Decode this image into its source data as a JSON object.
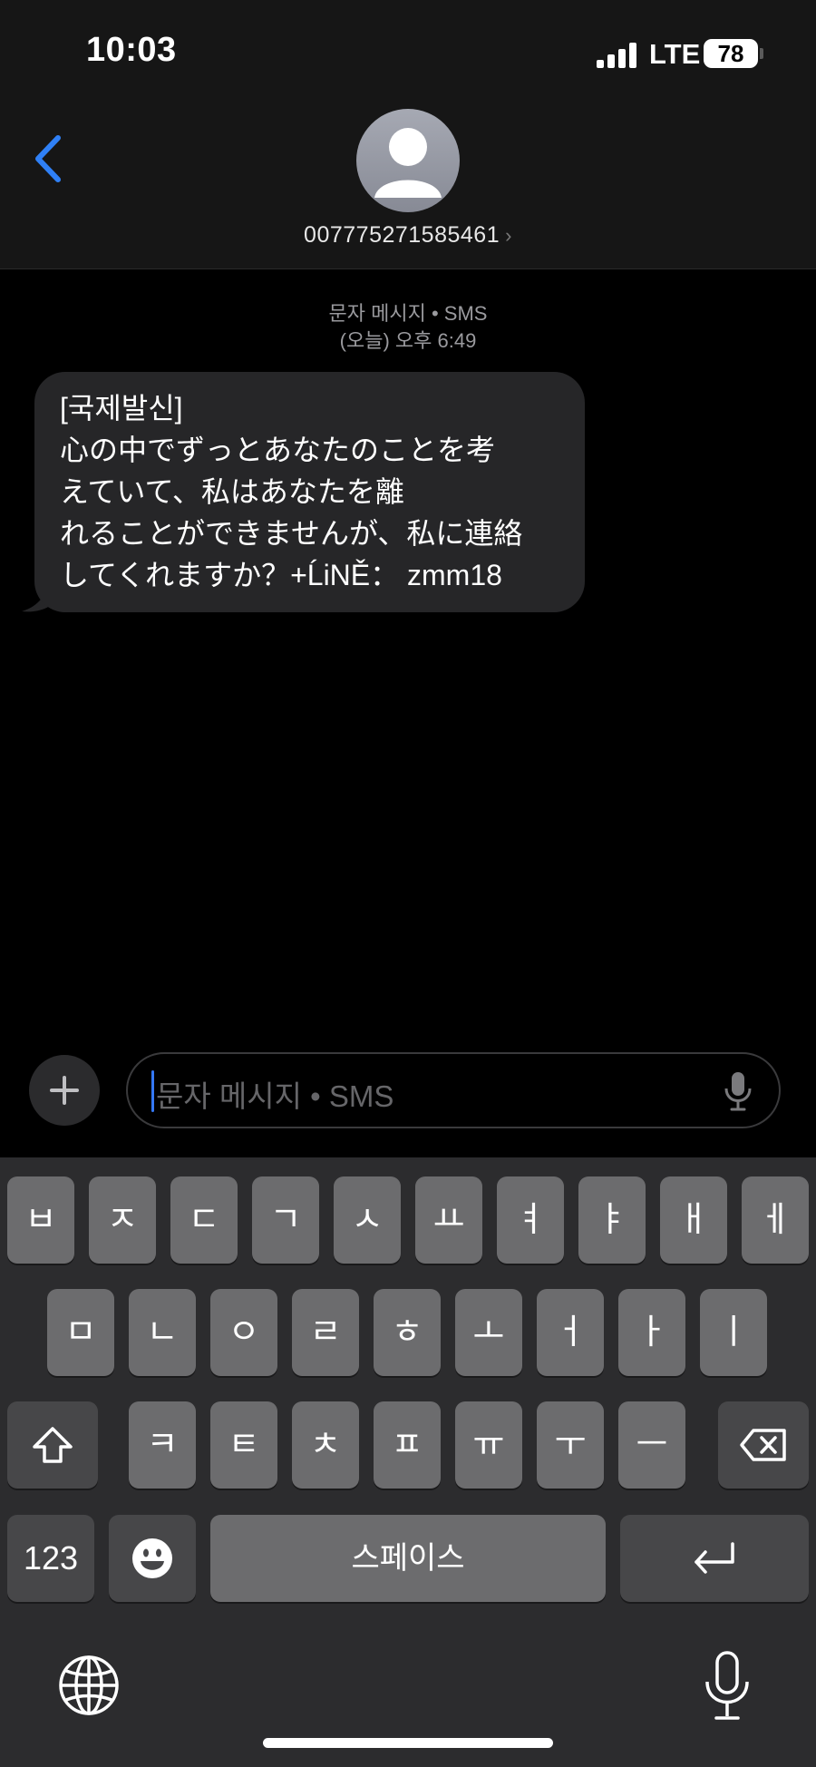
{
  "status_bar": {
    "time": "10:03",
    "network": "LTE",
    "battery": "78"
  },
  "header": {
    "contact_name": "007775271585461",
    "chevron": "›"
  },
  "conversation": {
    "meta_type": "문자 메시지 • SMS",
    "meta_timestamp": "(오늘) 오후 6:49",
    "message": {
      "line1": "[국제발신]",
      "line2": "心の中でずっとあなたのことを考",
      "line3": "えていて、私はあなたを離",
      "line4": "れることができませんが、私に連絡",
      "line5": "してくれますか？+ĹiNĚ：  zmm18"
    }
  },
  "input": {
    "placeholder": "문자 메시지 • SMS",
    "plus_label": "+"
  },
  "keyboard": {
    "row1": [
      "ㅂ",
      "ㅈ",
      "ㄷ",
      "ㄱ",
      "ㅅ",
      "ㅛ",
      "ㅕ",
      "ㅑ",
      "ㅐ",
      "ㅔ"
    ],
    "row2": [
      "ㅁ",
      "ㄴ",
      "ㅇ",
      "ㄹ",
      "ㅎ",
      "ㅗ",
      "ㅓ",
      "ㅏ",
      "ㅣ"
    ],
    "row3": [
      "ㅋ",
      "ㅌ",
      "ㅊ",
      "ㅍ",
      "ㅠ",
      "ㅜ",
      "ㅡ"
    ],
    "numbers_label": "123",
    "space_label": "스페이스"
  },
  "icons": {
    "back": "chevron-left-icon",
    "avatar": "person-icon",
    "mic": "microphone-icon",
    "shift": "shift-icon",
    "delete": "delete-icon",
    "emoji": "emoji-icon",
    "return": "return-icon",
    "globe": "globe-icon"
  },
  "colors": {
    "accent": "#3478f6",
    "bubble": "#262628",
    "keyboard_bg": "#2c2c2e",
    "key": "#6c6c6e",
    "key_dark": "#474749"
  }
}
